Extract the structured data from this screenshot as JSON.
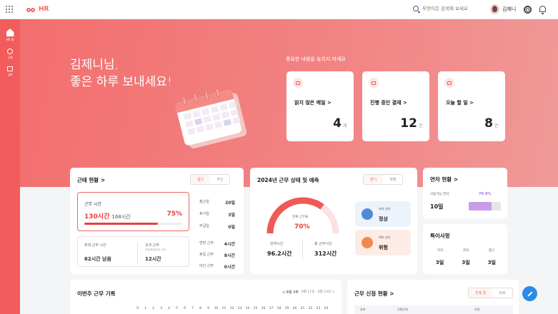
{
  "app": {
    "name": "HR"
  },
  "search": {
    "placeholder": "무엇이든 검색해 보세요"
  },
  "user": {
    "name": "김제니"
  },
  "sidebar": {
    "items": [
      {
        "label": "HR 홈"
      },
      {
        "label": "근태"
      },
      {
        "label": "급여"
      }
    ]
  },
  "hero": {
    "greeting_line1": "김제니님,",
    "greeting_line2": "좋은 하루 보내세요!",
    "notice": "중요한 내용을 놓치지 마세요"
  },
  "summary_cards": [
    {
      "label": "읽지 않은 메일",
      "count": "4",
      "unit": "개"
    },
    {
      "label": "진행 중인 결재",
      "count": "12",
      "unit": "건"
    },
    {
      "label": "오늘 할 일",
      "count": "8",
      "unit": "건"
    }
  ],
  "attendance": {
    "title": "근태 현황",
    "tabs": [
      "일간",
      "주간"
    ],
    "work_time_label": "근무 시간",
    "work_time_value": "130시간",
    "work_time_total": "168시간",
    "work_time_percent": "75%",
    "work_time_fraction": 0.75,
    "stats": [
      {
        "label": "출근일",
        "value": "20일"
      },
      {
        "label": "휴가일",
        "value": "3일"
      },
      {
        "label": "무급일",
        "value": "0일"
      }
    ],
    "max_label": "최대 근무 시간",
    "max_value": "62시간 남음",
    "over_label": "초과 근무",
    "over_sub": "연장/휴일/야간 근무",
    "over_value": "12시간",
    "over_stats": [
      {
        "label": "연장 근무",
        "value": "4시간"
      },
      {
        "label": "휴일 근무",
        "value": "8시간"
      },
      {
        "label": "야간 근무",
        "value": "0시간"
      }
    ]
  },
  "work_status": {
    "title": "2024년 근무 상태 및 예측",
    "tabs": [
      "분기",
      "월별"
    ],
    "gauge_label": "현재 근무율",
    "gauge_value": "70%",
    "gauge_fraction": 0.7,
    "remaining_label": "잔여시간",
    "remaining_value": "96.2시간",
    "total_label": "총 근무시간",
    "total_value": "312시간",
    "current_label": "현재 상태",
    "current_value": "정상",
    "forecast_label": "예측 상태",
    "forecast_value": "위험"
  },
  "leave": {
    "title": "연차 현황",
    "used_label": "사용가능 연차",
    "used_percent": "70.9%",
    "used_fraction": 0.709,
    "days": "10일"
  },
  "special": {
    "title": "특이사항",
    "items": [
      {
        "label": "지각",
        "value": "3일"
      },
      {
        "label": "조퇴",
        "value": "3일"
      },
      {
        "label": "결근",
        "value": "3일"
      }
    ]
  },
  "weekly": {
    "title": "이번주 근무 기록",
    "week_label": "8월 3주",
    "range": "8월 11일 - 8월 16일",
    "hours": [
      "0",
      "1",
      "2",
      "3",
      "4",
      "5",
      "6",
      "7",
      "8",
      "9",
      "10",
      "11",
      "12",
      "13",
      "14",
      "15",
      "16",
      "17",
      "18",
      "19",
      "20",
      "21",
      "22",
      "23",
      "24"
    ]
  },
  "requests": {
    "title": "근무 신청 현황",
    "tabs": [
      "진행 중",
      "완료"
    ],
    "columns": [
      "날짜",
      "진행상태",
      "유형"
    ]
  },
  "colors": {
    "accent": "#f0645f",
    "sidebar": "#f25c5c",
    "danger": "#e6403d",
    "fab": "#2b8ae6"
  }
}
